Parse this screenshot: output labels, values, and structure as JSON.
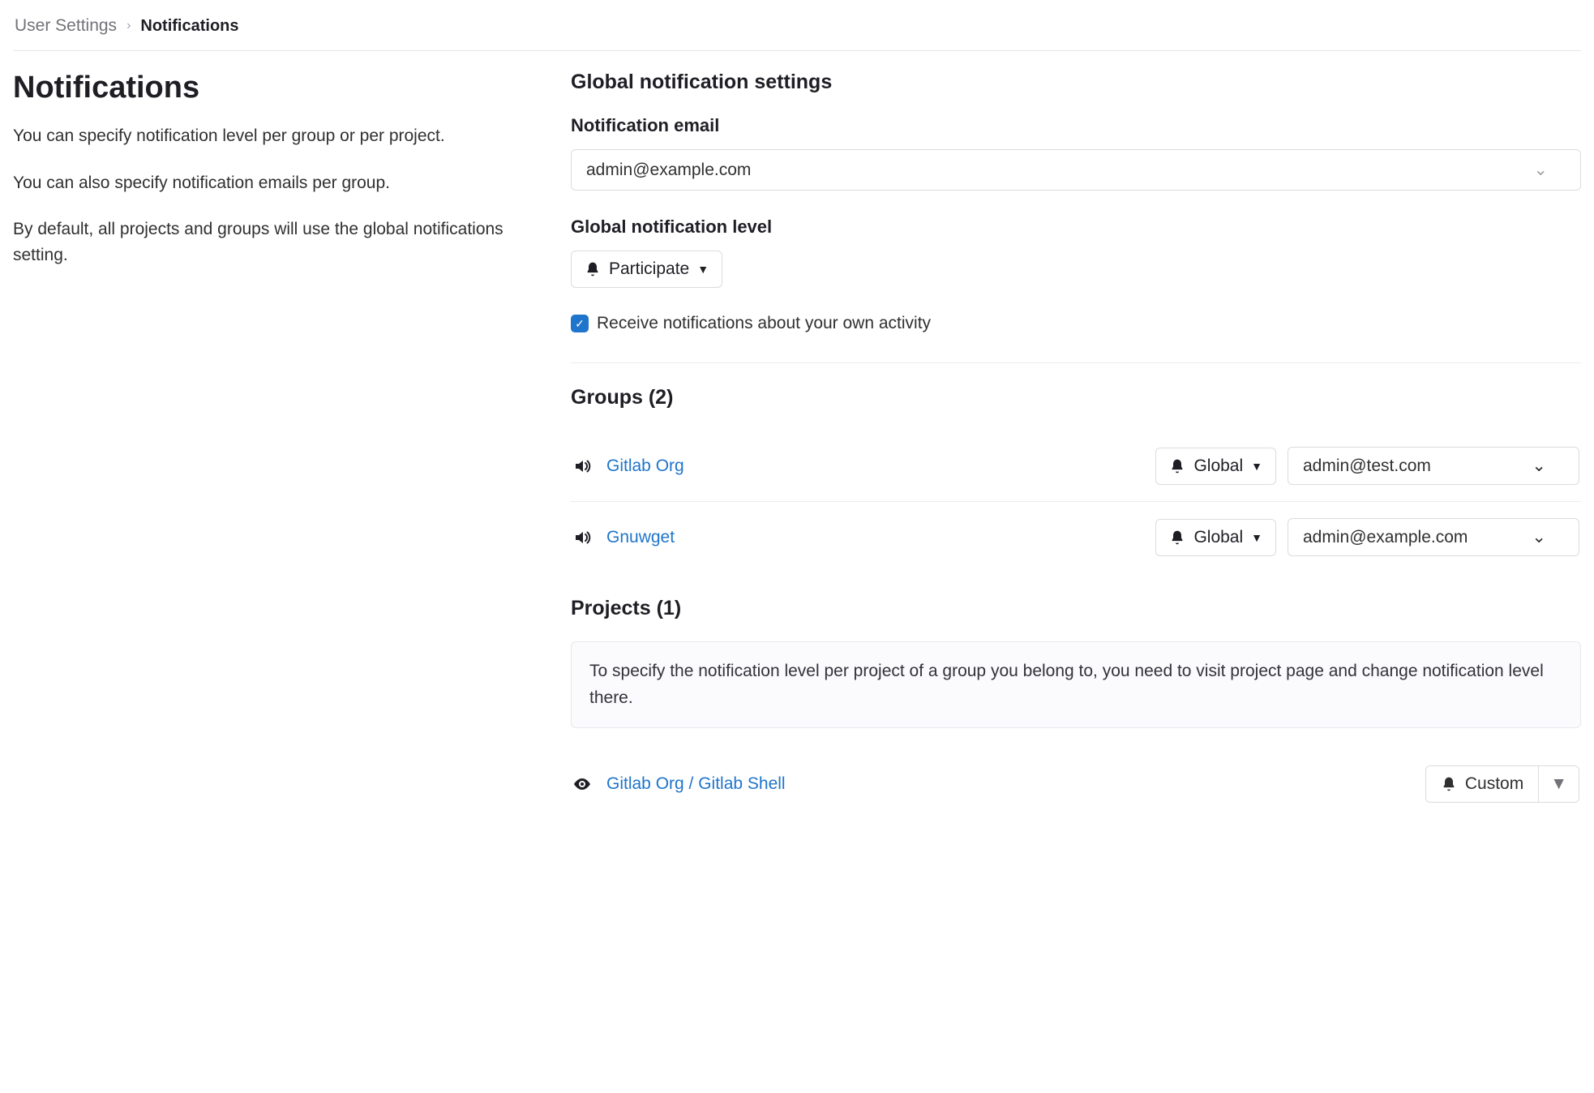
{
  "breadcrumb": {
    "parent": "User Settings",
    "current": "Notifications"
  },
  "sidebar": {
    "title": "Notifications",
    "p1": "You can specify notification level per group or per project.",
    "p2": "You can also specify notification emails per group.",
    "p3": "By default, all projects and groups will use the global notifications setting."
  },
  "global": {
    "heading": "Global notification settings",
    "email_label": "Notification email",
    "email_value": "admin@example.com",
    "level_label": "Global notification level",
    "level_value": "Participate",
    "self_activity_label": "Receive notifications about your own activity",
    "self_activity_checked": true
  },
  "groups": {
    "heading": "Groups (2)",
    "items": [
      {
        "name": "Gitlab Org",
        "level": "Global",
        "email": "admin@test.com"
      },
      {
        "name": "Gnuwget",
        "level": "Global",
        "email": "admin@example.com"
      }
    ]
  },
  "projects": {
    "heading": "Projects (1)",
    "info": "To specify the notification level per project of a group you belong to, you need to visit project page and change notification level there.",
    "items": [
      {
        "name": "Gitlab Org / Gitlab Shell",
        "level": "Custom"
      }
    ]
  }
}
